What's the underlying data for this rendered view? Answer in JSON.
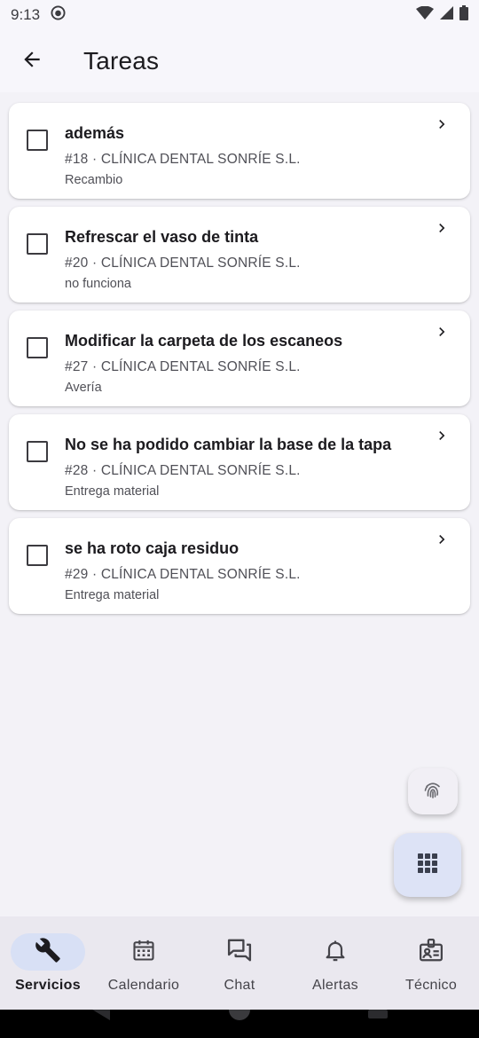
{
  "status_bar": {
    "time": "9:13"
  },
  "app_bar": {
    "title": "Tareas"
  },
  "tasks": [
    {
      "title": "además",
      "subtitle": "#18 · CLÍNICA DENTAL SONRÍE S.L.",
      "type": "Recambio"
    },
    {
      "title": "Refrescar el vaso de tinta",
      "subtitle": "#20 · CLÍNICA DENTAL SONRÍE S.L.",
      "type": "no funciona"
    },
    {
      "title": "Modificar la carpeta de los escaneos",
      "subtitle": "#27 · CLÍNICA DENTAL SONRÍE S.L.",
      "type": "Avería"
    },
    {
      "title": "No se ha podido cambiar la base de la tapa",
      "subtitle": "#28 · CLÍNICA DENTAL SONRÍE S.L.",
      "type": "Entrega material"
    },
    {
      "title": "se ha roto caja residuo",
      "subtitle": "#29 · CLÍNICA DENTAL SONRÍE S.L.",
      "type": "Entrega material"
    }
  ],
  "bottom_nav": {
    "items": [
      {
        "label": "Servicios",
        "icon": "wrench-icon",
        "active": true
      },
      {
        "label": "Calendario",
        "icon": "calendar-icon",
        "active": false
      },
      {
        "label": "Chat",
        "icon": "chat-icon",
        "active": false
      },
      {
        "label": "Alertas",
        "icon": "bell-icon",
        "active": false
      },
      {
        "label": "Técnico",
        "icon": "badge-icon",
        "active": false
      }
    ]
  },
  "colors": {
    "background": "#f3f2f7",
    "card": "#ffffff",
    "nav_active_pill": "#d8e0f5",
    "fab_primary": "#dde3f6"
  }
}
